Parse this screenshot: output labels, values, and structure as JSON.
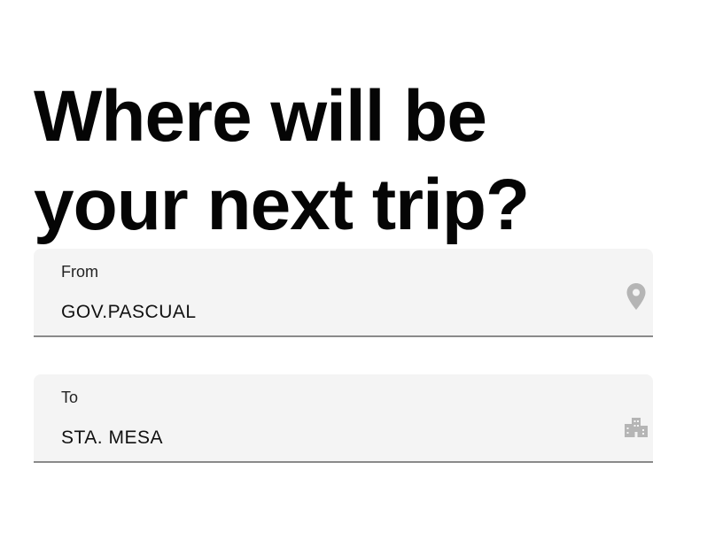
{
  "heading": {
    "line1": "Where will be",
    "line2": "your next trip?"
  },
  "from_field": {
    "label": "From",
    "value": "GOV.PASCUAL",
    "icon": "location-pin-icon"
  },
  "to_field": {
    "label": "To",
    "value": "STA. MESA",
    "icon": "buildings-icon"
  },
  "colors": {
    "field_background": "#f4f4f4",
    "field_underline": "#8a8a8a",
    "icon_gray": "#b5b5b5"
  }
}
